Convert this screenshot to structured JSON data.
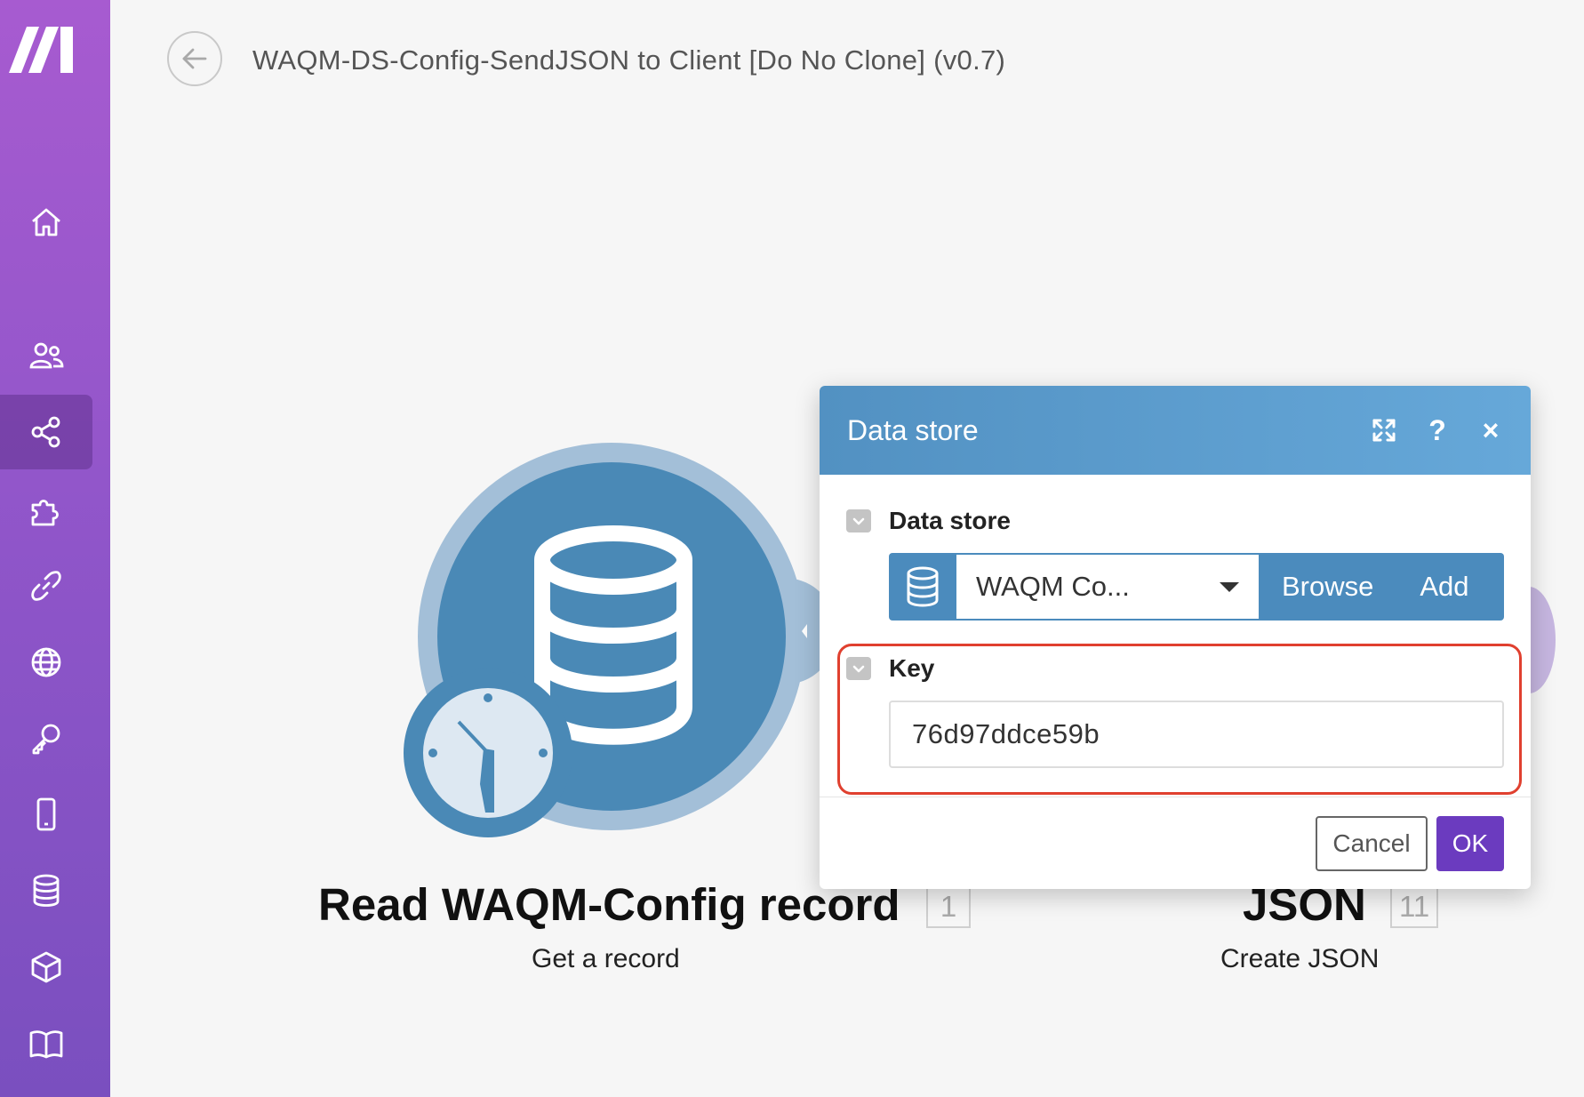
{
  "app": {
    "scenario_title": "WAQM-DS-Config-SendJSON to Client [Do No Clone] (v0.7)",
    "accent_color": "#6b3bbf",
    "sidebar_gradient": [
      "#a75bd0",
      "#7a4fbf"
    ]
  },
  "sidebar": {
    "logo": "make-logo-icon",
    "items": [
      {
        "icon": "home-icon"
      },
      {
        "icon": "team-icon"
      },
      {
        "icon": "share-nodes-icon",
        "active": true
      },
      {
        "icon": "puzzle-icon"
      },
      {
        "icon": "link-icon"
      },
      {
        "icon": "globe-icon"
      },
      {
        "icon": "key-icon"
      },
      {
        "icon": "mobile-icon"
      },
      {
        "icon": "database-icon"
      },
      {
        "icon": "cube-icon"
      },
      {
        "icon": "book-icon"
      }
    ]
  },
  "canvas": {
    "module_left": {
      "title": "Read WAQM-Config record",
      "subtitle": "Get a record",
      "badge": "1",
      "color": "#4a89b6"
    },
    "module_right": {
      "title": "JSON",
      "subtitle": "Create JSON",
      "badge": "11"
    }
  },
  "dialog": {
    "title": "Data store",
    "header_icons": [
      "expand-icon",
      "help-icon",
      "close-icon"
    ],
    "help_glyph": "?",
    "close_glyph": "×",
    "data_store_field": {
      "label": "Data store",
      "selected_value": "WAQM Co...",
      "browse_label": "Browse",
      "add_label": "Add"
    },
    "key_field": {
      "label": "Key",
      "value": "76d97ddce59b",
      "highlight_color": "#e0402f"
    },
    "cancel_label": "Cancel",
    "ok_label": "OK"
  }
}
